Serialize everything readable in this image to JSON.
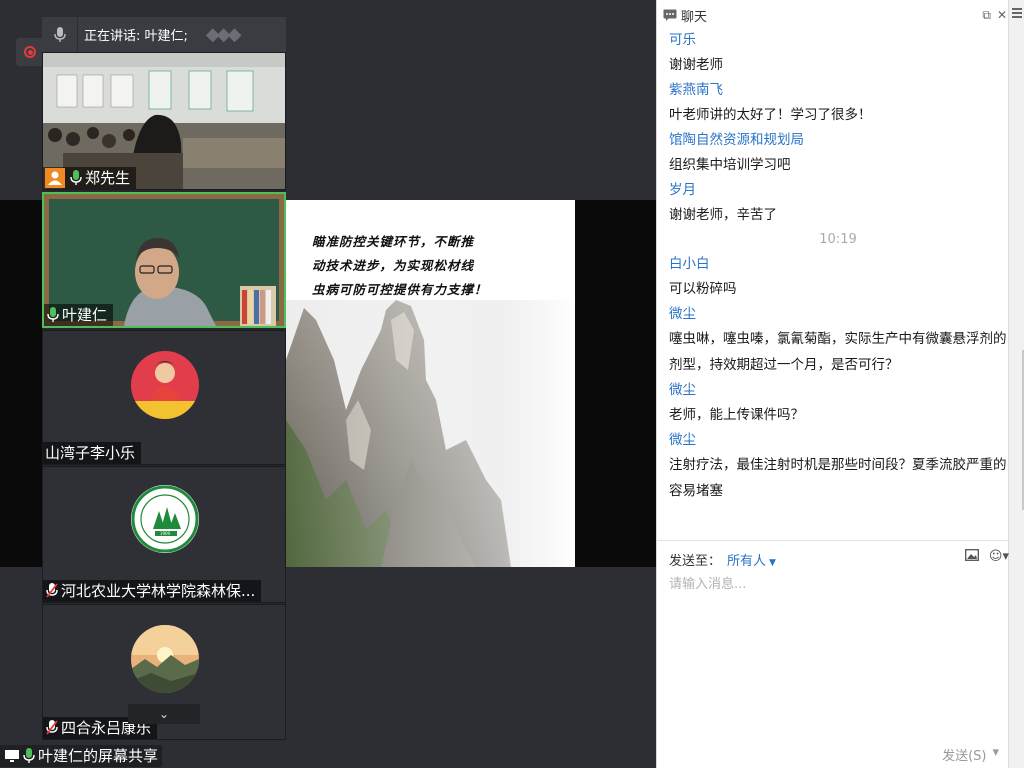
{
  "speaking": {
    "label": "正在讲话: 叶建仁;"
  },
  "tiles": [
    {
      "name": "郑先生"
    },
    {
      "name": "叶建仁"
    },
    {
      "name": "山湾子李小乐"
    },
    {
      "name": "河北农业大学林学院森林保..."
    },
    {
      "name": "四合永吕康乐"
    }
  ],
  "slide": {
    "lines": [
      "瞄准防控关键环节，不断推",
      "动技术进步，为实现松材线",
      "虫病可防可控提供有力支撑！"
    ]
  },
  "share_label": "叶建仁的屏幕共享",
  "chat": {
    "title": "聊天",
    "messages": [
      {
        "sender": "可乐",
        "text": "谢谢老师"
      },
      {
        "sender": "紫燕南飞",
        "text": "叶老师讲的太好了！学习了很多！"
      },
      {
        "sender": "馆陶自然资源和规划局",
        "text": "组织集中培训学习吧"
      },
      {
        "sender": "岁月",
        "text": " 谢谢老师，辛苦了"
      },
      {
        "time": "10:19"
      },
      {
        "sender": "白小白",
        "text": "可以粉碎吗"
      },
      {
        "sender": "微尘",
        "text": "噻虫啉，噻虫嗪，氯氰菊酯，实际生产中有微囊悬浮剂的剂型，持效期超过一个月，是否可行？"
      },
      {
        "sender": "微尘",
        "text": "老师，能上传课件吗？"
      },
      {
        "sender": "微尘",
        "text": "注射疗法，最佳注射时机是那些时间段？夏季流胶严重的容易堵塞"
      }
    ],
    "send_to_label": "发送至：",
    "send_to_target": "所有人",
    "input_placeholder": "请输入消息...",
    "send_label": "发送(S)"
  },
  "colors": {
    "accent": "#2a73c9",
    "active_border": "#4fbf5a",
    "record": "#e23b3b"
  }
}
